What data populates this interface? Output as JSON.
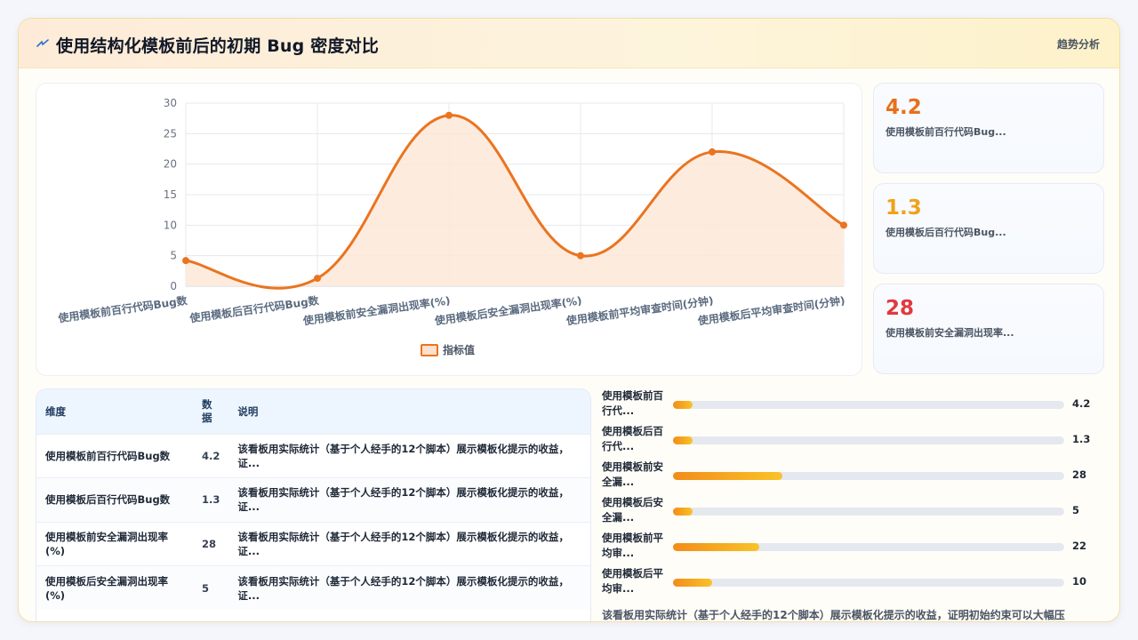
{
  "header": {
    "title": "使用结构化模板前后的初期 Bug 密度对比",
    "right_tag": "趋势分析",
    "accent": "#e8701a"
  },
  "chart_data": {
    "type": "line",
    "categories": [
      "使用模板前百行代码Bug数",
      "使用模板后百行代码Bug数",
      "使用模板前安全漏洞出现率(%)",
      "使用模板后安全漏洞出现率(%)",
      "使用模板前平均审查时间(分钟)",
      "使用模板后平均审查时间(分钟)"
    ],
    "series": [
      {
        "name": "指标值",
        "values": [
          4.2,
          1.3,
          28,
          5,
          22,
          10
        ]
      }
    ],
    "yticks": [
      "0",
      "5",
      "10",
      "15",
      "20",
      "25",
      "30"
    ],
    "ylim": [
      0,
      30
    ],
    "grid": true,
    "legend": "bottom",
    "line_color": "#ea7420",
    "fill_color": "#fde7d8"
  },
  "stats": [
    {
      "value": "4.2",
      "label": "使用模板前百行代码Bug...",
      "color": "#e8701a"
    },
    {
      "value": "1.3",
      "label": "使用模板后百行代码Bug...",
      "color": "#f0a21a"
    },
    {
      "value": "28",
      "label": "使用模板前安全漏洞出现率...",
      "color": "#e0393e"
    }
  ],
  "table": {
    "headers": [
      "维度",
      "数据",
      "说明"
    ],
    "rows": [
      {
        "dim": "使用模板前百行代码Bug数",
        "val": "4.2",
        "desc_l1": "该看板用实际统计（基于个人经手的12个脚本）展示模板化提示的收益，",
        "desc_l2": "证..."
      },
      {
        "dim": "使用模板后百行代码Bug数",
        "val": "1.3",
        "desc_l1": "该看板用实际统计（基于个人经手的12个脚本）展示模板化提示的收益，",
        "desc_l2": "证..."
      },
      {
        "dim": "使用模板前安全漏洞出现率(%)",
        "val": "28",
        "desc_l1": "该看板用实际统计（基于个人经手的12个脚本）展示模板化提示的收益，",
        "desc_l2": "证..."
      },
      {
        "dim": "使用模板后安全漏洞出现率(%)",
        "val": "5",
        "desc_l1": "该看板用实际统计（基于个人经手的12个脚本）展示模板化提示的收益，",
        "desc_l2": "证..."
      }
    ]
  },
  "bars": {
    "max": 100,
    "items": [
      {
        "label_l1": "使用模板前百",
        "label_l2": "行代...",
        "value": 4.2,
        "display": "4.2"
      },
      {
        "label_l1": "使用模板后百",
        "label_l2": "行代...",
        "value": 1.3,
        "display": "1.3"
      },
      {
        "label_l1": "使用模板前安",
        "label_l2": "全漏...",
        "value": 28,
        "display": "28"
      },
      {
        "label_l1": "使用模板后安",
        "label_l2": "全漏...",
        "value": 5,
        "display": "5"
      },
      {
        "label_l1": "使用模板前平",
        "label_l2": "均审...",
        "value": 22,
        "display": "22"
      },
      {
        "label_l1": "使用模板后平",
        "label_l2": "均审...",
        "value": 10,
        "display": "10"
      }
    ]
  },
  "summary": "该看板用实际统计（基于个人经手的12个脚本）展示模板化提示的收益，证明初始约束可以大幅压"
}
